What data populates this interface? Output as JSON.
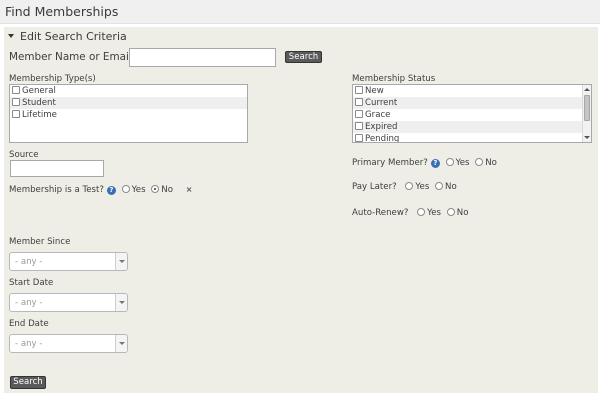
{
  "page": {
    "title": "Find Memberships"
  },
  "criteria": {
    "heading": "Edit Search Criteria",
    "member_name_label": "Member Name or Email",
    "member_name_value": "",
    "search_label": "Search",
    "membership_type_label": "Membership Type(s)",
    "membership_types": [
      {
        "label": "General",
        "checked": false
      },
      {
        "label": "Student",
        "checked": false
      },
      {
        "label": "Lifetime",
        "checked": false
      }
    ],
    "membership_status_label": "Membership Status",
    "membership_statuses": [
      {
        "label": "New",
        "checked": false
      },
      {
        "label": "Current",
        "checked": false
      },
      {
        "label": "Grace",
        "checked": false
      },
      {
        "label": "Expired",
        "checked": false
      },
      {
        "label": "Pending",
        "checked": false
      }
    ],
    "source_label": "Source",
    "source_value": "",
    "test_label": "Membership is a Test?",
    "test_selected": "No",
    "primary_label": "Primary Member?",
    "primary_selected": "",
    "paylater_label": "Pay Later?",
    "paylater_selected": "",
    "autorenew_label": "Auto-Renew?",
    "autorenew_selected": "",
    "yes": "Yes",
    "no": "No",
    "help_glyph": "?",
    "clear_glyph": "×",
    "member_since_label": "Member Since",
    "start_date_label": "Start Date",
    "end_date_label": "End Date",
    "any_option": "- any -",
    "bottom_search_label": "Search"
  }
}
